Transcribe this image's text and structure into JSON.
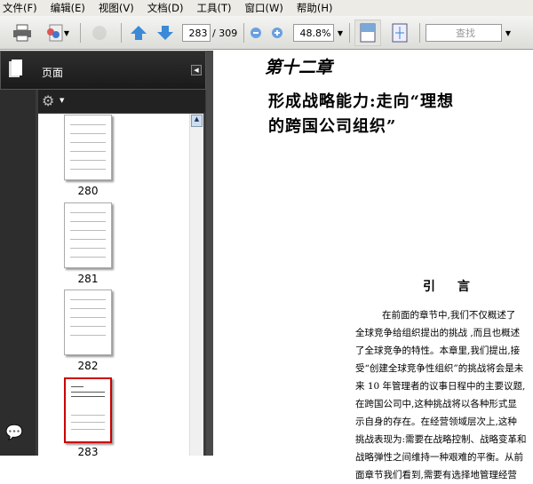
{
  "menu": [
    "文件(F)",
    "编辑(E)",
    "视图(V)",
    "文档(D)",
    "工具(T)",
    "窗口(W)",
    "帮助(H)"
  ],
  "toolbar": {
    "page_current": "283",
    "page_total": "/ 309",
    "zoom": "48.8%",
    "search_placeholder": "查找"
  },
  "panel": {
    "title": "页面",
    "thumbnails": [
      {
        "label": "280",
        "selected": false
      },
      {
        "label": "281",
        "selected": false
      },
      {
        "label": "282",
        "selected": false
      },
      {
        "label": "283",
        "selected": true
      }
    ]
  },
  "document": {
    "chapter": "第十二章",
    "title_line1": "形成战略能力:走向“理想",
    "title_line2": "的跨国公司组织”",
    "heading": "引 言",
    "paragraph_lines": [
      "在前面的章节中,我们不仅概述了",
      "全球竞争给组织提出的挑战 ,而且也概述",
      "了全球竞争的特性。本章里,我们提出,接",
      "受“创建全球竞争性组织”的挑战将会是未",
      "来 10 年管理者的议事日程中的主要议题,",
      "在跨国公司中,这种挑战将以各种形式显",
      "示自身的存在。在经营领域层次上,这种",
      "挑战表现为:需要在战略控制、战略变革和",
      "战略弹性之间维持一种艰难的平衡。从前",
      "面章节我们看到,需要有选择地管理经营"
    ]
  },
  "colors": {
    "selected_border": "#cc0000",
    "panel_bg": "#3a3a3a"
  }
}
